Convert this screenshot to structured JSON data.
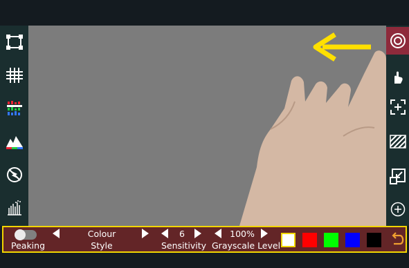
{
  "left_toolbar": {
    "icons": [
      "focus-frame-icon",
      "grid-icon",
      "rgb-parade-icon",
      "histogram-icon",
      "flash-off-icon",
      "waveform-icon"
    ]
  },
  "right_toolbar": {
    "icons": [
      "focus-peaking-icon",
      "hand-icon",
      "center-marker-icon",
      "zebra-stripes-icon",
      "scale-frame-icon",
      "add-icon"
    ],
    "active": "focus-peaking-icon"
  },
  "bottom_bar": {
    "peaking": {
      "label": "Peaking",
      "enabled": false
    },
    "colour_style": {
      "line1": "Colour",
      "line2": "Style"
    },
    "sensitivity": {
      "value": "6",
      "label": "Sensitivity"
    },
    "grayscale": {
      "value": "100%",
      "label": "Grayscale Level"
    },
    "swatches": [
      "#ffffff",
      "#ff0000",
      "#00ff00",
      "#0000ff",
      "#000000"
    ],
    "selected_swatch": "#ffffff"
  },
  "colors": {
    "bottom_bar_bg": "#632527",
    "highlight": "#f2d600",
    "rail_bg": "#1a2e2f",
    "active_icon_bg": "#8e2a3b",
    "undo_icon": "#f0a030"
  }
}
